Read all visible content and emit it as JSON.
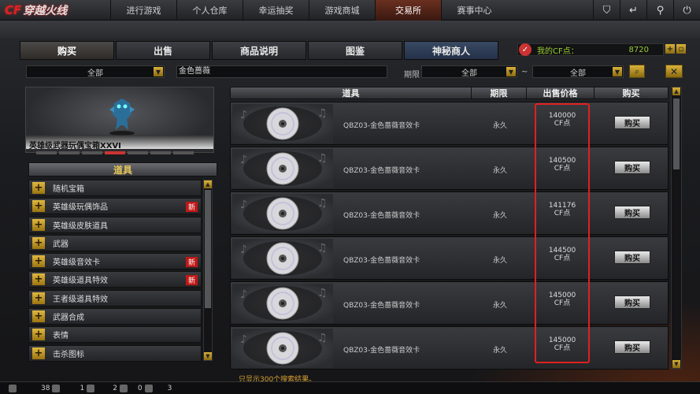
{
  "app": {
    "logo_text": "穿越火线"
  },
  "topnav": [
    {
      "label": "进行游戏"
    },
    {
      "label": "个人仓库"
    },
    {
      "label": "幸运抽奖"
    },
    {
      "label": "游戏商城"
    },
    {
      "label": "交易所",
      "active": true
    },
    {
      "label": "赛事中心"
    }
  ],
  "topicons": [
    "shield-icon",
    "logout-icon",
    "wrench-icon",
    "power-icon"
  ],
  "tabs": [
    {
      "label": "购买",
      "active": true
    },
    {
      "label": "出售"
    },
    {
      "label": "商品说明"
    },
    {
      "label": "图鉴"
    },
    {
      "label": "神秘商人"
    }
  ],
  "cf": {
    "label": "我的CF点：",
    "value": "8720"
  },
  "filters": {
    "category": "全部",
    "search_value": "金色蔷薇",
    "period_label": "期限",
    "period_from": "全部",
    "tilde": "~",
    "period_to": "全部"
  },
  "showcase": {
    "caption": "英雄级武器玩偶宝箱XXVI",
    "dots": 8,
    "active_dot": 3
  },
  "category_header": "道具",
  "categories": [
    {
      "label": "随机宝箱",
      "new": ""
    },
    {
      "label": "英雄级玩偶饰品",
      "new": "新"
    },
    {
      "label": "英雄级皮肤道具",
      "new": ""
    },
    {
      "label": "武器",
      "new": ""
    },
    {
      "label": "英雄级音效卡",
      "new": "新"
    },
    {
      "label": "英雄级道具特效",
      "new": "新"
    },
    {
      "label": "王者级道具特效",
      "new": ""
    },
    {
      "label": "武器合成",
      "new": ""
    },
    {
      "label": "表情",
      "new": ""
    },
    {
      "label": "击杀图标",
      "new": ""
    }
  ],
  "table": {
    "headers": [
      "道具",
      "期限",
      "出售价格",
      "购买"
    ],
    "rows": [
      {
        "name": "QBZ03-金色蔷薇音效卡",
        "period": "永久",
        "price": "140000",
        "unit": "CF点",
        "buy": "购买"
      },
      {
        "name": "QBZ03-金色蔷薇音效卡",
        "period": "永久",
        "price": "140500",
        "unit": "CF点",
        "buy": "购买"
      },
      {
        "name": "QBZ03-金色蔷薇音效卡",
        "period": "永久",
        "price": "141176",
        "unit": "CF点",
        "buy": "购买"
      },
      {
        "name": "QBZ03-金色蔷薇音效卡",
        "period": "永久",
        "price": "144500",
        "unit": "CF点",
        "buy": "购买"
      },
      {
        "name": "QBZ03-金色蔷薇音效卡",
        "period": "永久",
        "price": "145000",
        "unit": "CF点",
        "buy": "购买"
      },
      {
        "name": "QBZ03-金色蔷薇音效卡",
        "period": "永久",
        "price": "145000",
        "unit": "CF点",
        "buy": "购买"
      }
    ]
  },
  "footnote": "只显示300个搜索结果。",
  "statusbar": {
    "count1": "38",
    "count2": "1",
    "count3": "2",
    "count4": "0",
    "count5": "3"
  },
  "colors": {
    "accent_gold": "#d9b23a",
    "highlight_red": "#e02020",
    "new_badge": "#c01818",
    "cf_green": "#99cc33"
  }
}
